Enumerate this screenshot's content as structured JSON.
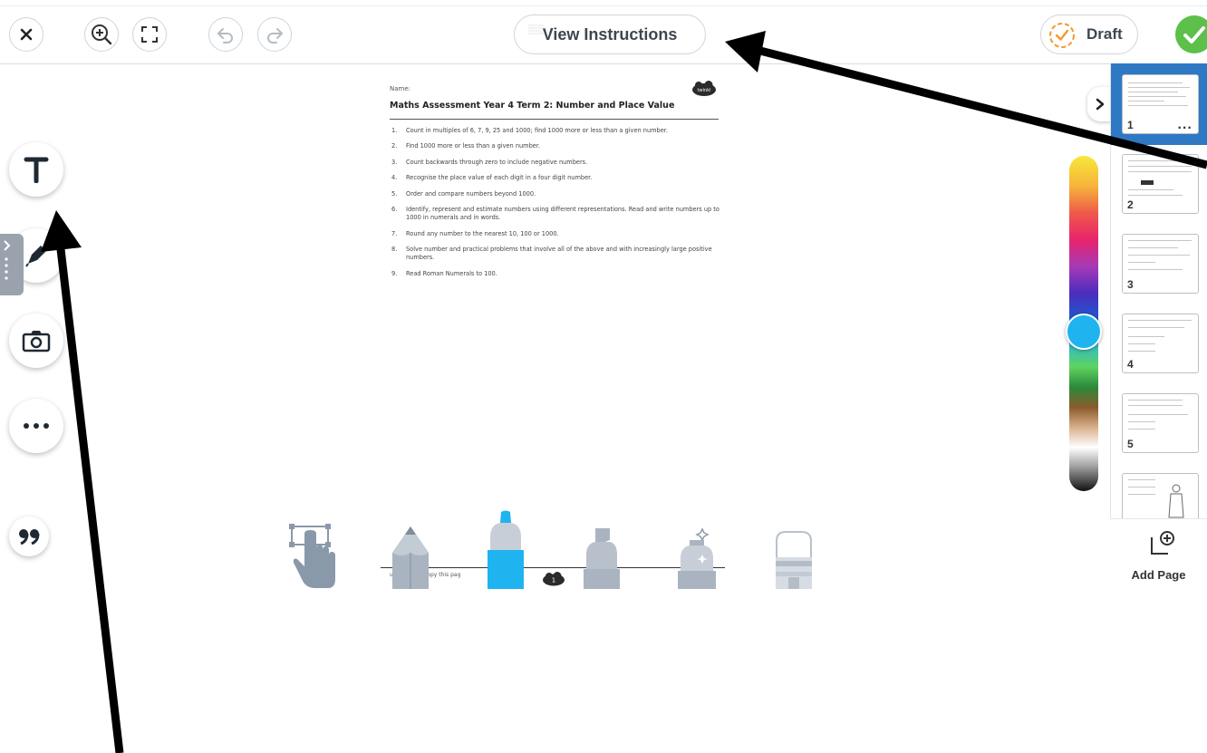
{
  "toolbar": {
    "close_icon": "close-icon",
    "zoom_in_icon": "zoom-in-icon",
    "fullscreen_icon": "fullscreen-icon",
    "undo_icon": "undo-icon",
    "redo_icon": "redo-icon",
    "view_instructions_label": "View Instructions",
    "draft_label": "Draft",
    "done_icon": "checkmark-icon",
    "accent_colors": {
      "draft_ring": "#f39a2b",
      "done": "#5cc04a",
      "selected_page": "#2f78c4"
    }
  },
  "left_tools": [
    {
      "name": "text",
      "icon": "text-T-icon"
    },
    {
      "name": "pen",
      "icon": "pen-icon"
    },
    {
      "name": "camera",
      "icon": "camera-icon"
    },
    {
      "name": "more",
      "icon": "more-dots-icon"
    },
    {
      "name": "quote",
      "icon": "quote-icon"
    }
  ],
  "document": {
    "name_label": "Name:",
    "title": "Maths Assessment Year 4 Term 2: Number and Place Value",
    "logo_text": "twinkl",
    "items": [
      {
        "num": "1.",
        "text": "Count in multiples of 6, 7, 9, 25 and 1000; find 1000 more or less than a given number."
      },
      {
        "num": "2.",
        "text": "Find 1000 more or less than a given number."
      },
      {
        "num": "3.",
        "text": "Count backwards through zero to include negative numbers."
      },
      {
        "num": "4.",
        "text": "Recognise the place value of each digit in a four digit number."
      },
      {
        "num": "5.",
        "text": "Order and compare numbers beyond 1000."
      },
      {
        "num": "6.",
        "text": "Identify, represent and estimate numbers using different representations. Read and write numbers up to 1000 in numerals and in words."
      },
      {
        "num": "7.",
        "text": "Round any number to the nearest 10, 100 or 1000."
      },
      {
        "num": "8.",
        "text": "Solve number and practical problems that involve all of the above and with increasingly large positive numbers."
      },
      {
        "num": "9.",
        "text": "Read Roman Numerals to 100."
      }
    ],
    "footer_text": "u may photocopy this pag",
    "page_badge": "1"
  },
  "color_palette": {
    "selected_color": "#1fb4f0"
  },
  "pages": {
    "collapse_icon": "chevron-right-icon",
    "thumbnails": [
      {
        "number": "1",
        "selected": true,
        "menu": "..."
      },
      {
        "number": "2"
      },
      {
        "number": "3"
      },
      {
        "number": "4"
      },
      {
        "number": "5"
      },
      {
        "number": ""
      }
    ],
    "add_page_label": "Add Page",
    "add_page_icon": "add-page-icon"
  },
  "tray": [
    {
      "name": "hand",
      "icon": "hand-select-icon"
    },
    {
      "name": "pencil",
      "icon": "pencil-icon"
    },
    {
      "name": "marker",
      "icon": "marker-icon",
      "selected": true
    },
    {
      "name": "highlighter",
      "icon": "highlighter-icon"
    },
    {
      "name": "sparkle-pen",
      "icon": "glitter-pen-icon"
    },
    {
      "name": "eraser",
      "icon": "eraser-icon"
    }
  ]
}
